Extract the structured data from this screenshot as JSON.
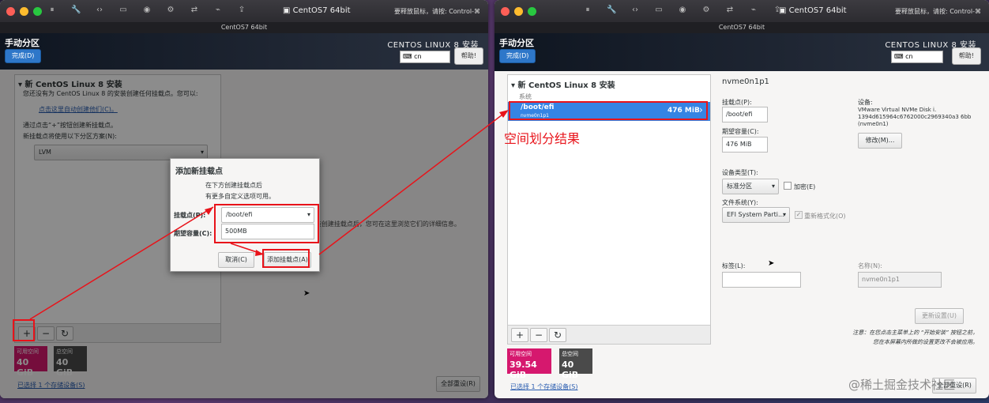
{
  "window_title": "CentOS7 64bit",
  "window_subtitle": "CentOS7 64bit",
  "status_right": "要释放鼠标，请按: Control-⌘",
  "header": {
    "title": "手动分区",
    "done": "完成(D)",
    "product": "CENTOS LINUX 8 安装",
    "keyboard": "cn",
    "help": "帮助!"
  },
  "left": {
    "section": "新 CentOS Linux 8 安装",
    "info1": "您还没有为 CentOS Linux 8 的安装创建任何挂载点。您可以:",
    "auto_link": "点击这里自动创建他们(C)。",
    "info2": "通过点击“+”按钮创建新挂载点。",
    "info3": "新挂载点将使用以下分区方案(N):",
    "scheme": "LVM",
    "info4": "在您为 CentOS Linux 8 安装创建挂载点后，您可在这里浏览它们的详细信息。",
    "avail_label": "可用空间",
    "avail": "40 GiB",
    "total_label": "总空间",
    "total": "40 GiB",
    "storage_link": "已选择 1 个存储设备(S)",
    "reset": "全部重设(R)"
  },
  "dialog": {
    "title": "添加新挂载点",
    "desc1": "在下方创建挂载点后",
    "desc2": "有更多自定义选项可用。",
    "mount_label": "挂载点(P):",
    "mount_value": "/boot/efi",
    "capacity_label": "期望容量(C):",
    "capacity_value": "500MB",
    "cancel": "取消(C)",
    "add": "添加挂载点(A)"
  },
  "right": {
    "section": "新 CentOS Linux 8 安装",
    "system": "系统",
    "item_mount": "/boot/efi",
    "item_dev": "nvme0n1p1",
    "item_size": "476 MiB",
    "annotation": "空间划分结果",
    "detail_title": "nvme0n1p1",
    "mount_label": "挂载点(P):",
    "mount_value": "/boot/efi",
    "capacity_label": "期望容量(C):",
    "capacity_value": "476 MiB",
    "device_label": "设备:",
    "device_value": "VMware Virtual NVMe Disk i. 1394d615964c6762000c2969340a3 6bb (nvme0n1)",
    "modify": "修改(M)...",
    "devtype_label": "设备类型(T):",
    "devtype": "标准分区",
    "encrypt": "加密(E)",
    "fs_label": "文件系统(Y):",
    "fs": "EFI System Parti...",
    "reformat": "重新格式化(O)",
    "tag_label": "标签(L):",
    "name_label": "名称(N):",
    "name_value": "nvme0n1p1",
    "update": "更新设置(U)",
    "note1": "注意：在您点击主菜单上的 “开始安装” 按钮之前，",
    "note2": "您在本屏幕内所做的设置更改不会被应用。",
    "avail_label": "可用空间",
    "avail": "39.54 GiB",
    "total_label": "总空间",
    "total": "40 GiB",
    "storage_link": "已选择 1 个存储设备(S)",
    "reset": "全部重设(R)"
  },
  "watermark": "@稀土掘金技术社区",
  "colors": {
    "accent": "#2e77c9",
    "annotation": "#e8131a",
    "avail": "#d6186e",
    "total": "#4a4a4a"
  }
}
